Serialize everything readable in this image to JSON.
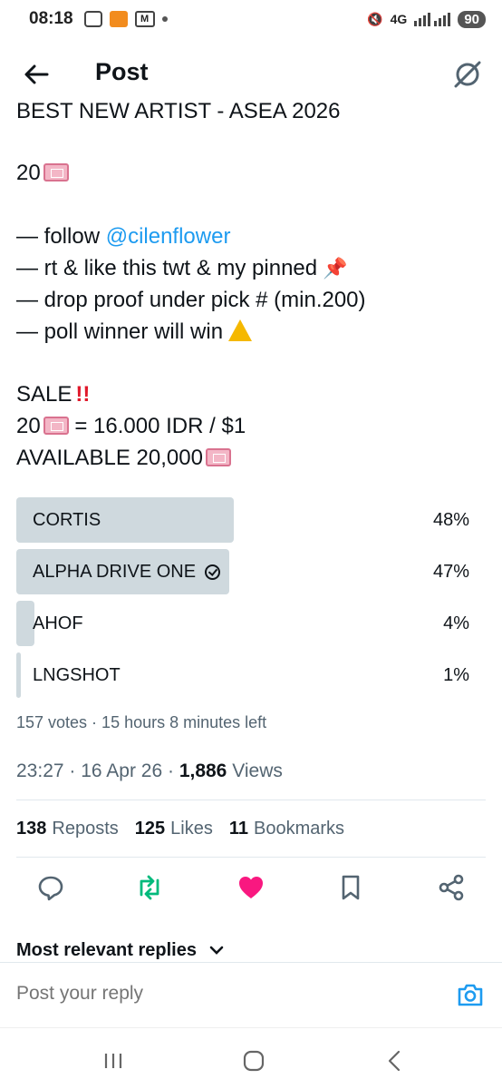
{
  "status_bar": {
    "time": "08:18",
    "network": "4G",
    "battery": "90"
  },
  "header": {
    "title": "Post"
  },
  "post": {
    "cut_line": "BEST NEW ARTIST - ASEA 2026",
    "count_line": "20",
    "follow_prefix": "— follow ",
    "mention": "@cilenflower",
    "line_rt": "— rt & like this twt & my pinned",
    "line_proof": "— drop proof under pick # (min.200)",
    "line_poll": "— poll winner will win",
    "sale": "SALE",
    "price_prefix": "20",
    "price_suffix": " = 16.000 IDR / $1",
    "available": "AVAILABLE 20,000"
  },
  "poll": {
    "options": [
      {
        "label": "CORTIS",
        "percent": "48%",
        "fraction": 0.48
      },
      {
        "label": "ALPHA DRIVE ONE",
        "percent": "47%",
        "fraction": 0.47,
        "selected": true
      },
      {
        "label": "AHOF",
        "percent": "4%",
        "fraction": 0.04
      },
      {
        "label": "LNGSHOT",
        "percent": "1%",
        "fraction": 0.01
      }
    ],
    "summary": "157 votes · 15 hours 8 minutes left"
  },
  "meta": {
    "time": "23:27",
    "date": "16 Apr 26",
    "views_count": "1,886",
    "views_label": "Views"
  },
  "stats": {
    "reposts_count": "138",
    "reposts_label": "Reposts",
    "likes_count": "125",
    "likes_label": "Likes",
    "bookmarks_count": "11",
    "bookmarks_label": "Bookmarks"
  },
  "replies": {
    "sort_label": "Most relevant replies",
    "placeholder": "Post your reply"
  },
  "colors": {
    "accent": "#1d9bf0",
    "repost_active": "#00ba7c",
    "like_active": "#f91880",
    "poll_fill": "#cfd9de"
  }
}
